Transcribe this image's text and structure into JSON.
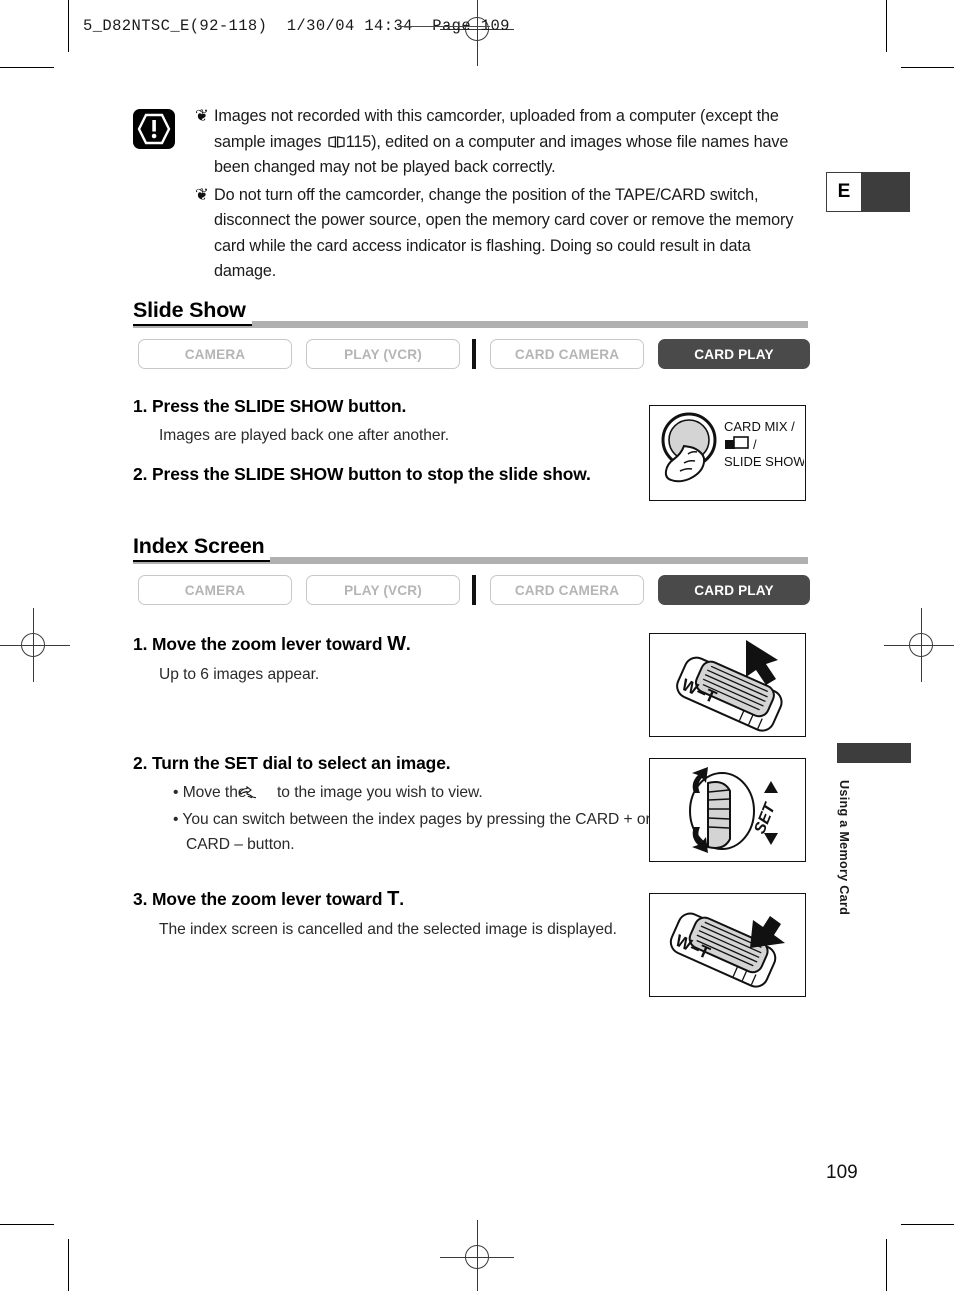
{
  "document": {
    "film_header": "5_D82NTSC_E(92-118)  1/30/04 14:34  Page 109",
    "page_number": "109",
    "language_tab": "E",
    "side_tab_label": "Using a Memory Card"
  },
  "caution": {
    "icon_name": "warning-exclamation-icon",
    "items": [
      {
        "bullet": "❦",
        "text_before": "Images not recorded with this camcorder, uploaded from a computer (except the sample images ",
        "ref_icon": "book-icon",
        "ref_page": "115",
        "text_after": "), edited on a computer and images whose file names have been changed may not be played back correctly."
      },
      {
        "bullet": "❦",
        "text": "Do not turn off the camcorder, change the position of the TAPE/CARD switch, disconnect the power source, open the memory card cover or remove the memory card while the card access indicator is flashing. Doing so could result in data damage."
      }
    ]
  },
  "sections": [
    {
      "id": "slide-show",
      "title": "Slide Show",
      "modes": [
        {
          "label": "CAMERA",
          "active": false
        },
        {
          "label": "PLAY (VCR)",
          "active": false
        },
        {
          "label": "CARD CAMERA",
          "active": false
        },
        {
          "label": "CARD PLAY",
          "active": true
        }
      ],
      "steps": [
        {
          "number": "1.",
          "title": "Press the SLIDE SHOW button.",
          "body": "Images are played back one after another."
        },
        {
          "number": "2.",
          "title": "Press the SLIDE SHOW button to stop the slide show.",
          "body": ""
        }
      ],
      "illustration": {
        "name": "slide-show-button-illustration",
        "labels": [
          "CARD MIX /",
          "/",
          "SLIDE SHOW"
        ],
        "card_mix_icon": "card-mix-icon"
      }
    },
    {
      "id": "index-screen",
      "title": "Index Screen",
      "modes": [
        {
          "label": "CAMERA",
          "active": false
        },
        {
          "label": "PLAY (VCR)",
          "active": false
        },
        {
          "label": "CARD CAMERA",
          "active": false
        },
        {
          "label": "CARD PLAY",
          "active": true
        }
      ],
      "steps": [
        {
          "number": "1.",
          "title_pre": "Move the zoom lever toward ",
          "title_emph": "W",
          "title_post": ".",
          "body": "Up to 6 images appear."
        },
        {
          "number": "2.",
          "title": "Turn the SET dial to select an image.",
          "sub_items": [
            {
              "pre": "• Move the ",
              "icon": "pointing-hand-icon",
              "post": " to the image you wish to view."
            },
            {
              "text": "• You can switch between the index pages by pressing the CARD + or CARD – button."
            }
          ]
        },
        {
          "number": "3.",
          "title_pre": "Move the zoom lever toward ",
          "title_emph": "T",
          "title_post": ".",
          "body": "The index screen is cancelled and the selected image is displayed."
        }
      ],
      "illustrations": [
        {
          "name": "zoom-lever-wide-illustration",
          "label": "W-T",
          "arrow": "up-left"
        },
        {
          "name": "set-dial-illustration",
          "label": "SET",
          "arrow": "rotate"
        },
        {
          "name": "zoom-lever-tele-illustration",
          "label": "W-T",
          "arrow": "down-right"
        }
      ]
    }
  ],
  "colors": {
    "active_button": "#4a4a4a",
    "inactive_border": "#c9c9c9",
    "inactive_text": "#b5b5b5",
    "rule_gray": "#b0b0b0",
    "tab_dark": "#3d3d3d"
  }
}
